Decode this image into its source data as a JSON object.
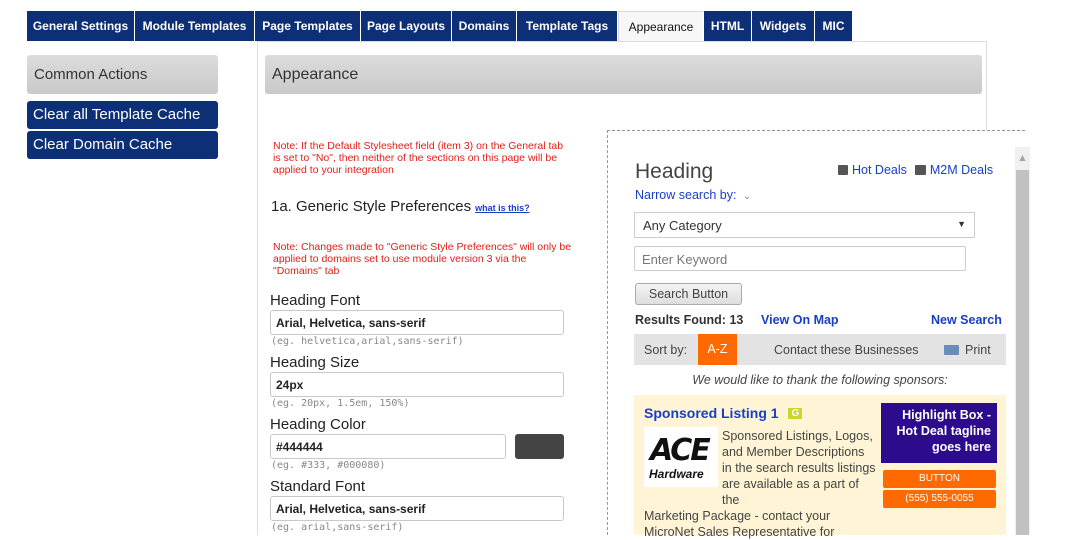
{
  "tabs": [
    {
      "label": "General Settings",
      "w": 108,
      "active": false
    },
    {
      "label": "Module Templates",
      "w": 120,
      "active": false
    },
    {
      "label": "Page Templates",
      "w": 106,
      "active": false
    },
    {
      "label": "Page Layouts",
      "w": 91,
      "active": false
    },
    {
      "label": "Domains",
      "w": 65,
      "active": false
    },
    {
      "label": "Template Tags",
      "w": 101,
      "active": false
    },
    {
      "label": "Appearance",
      "w": 86,
      "active": true
    },
    {
      "label": "HTML",
      "w": 48,
      "active": false
    },
    {
      "label": "Widgets",
      "w": 63,
      "active": false
    },
    {
      "label": "MIC",
      "w": 38,
      "active": false
    }
  ],
  "sidebar": {
    "title": "Common Actions",
    "actions": [
      "Clear all Template Cache",
      "Clear Domain Cache"
    ]
  },
  "panel": {
    "title": "Appearance"
  },
  "form": {
    "note1": "Note: If the Default Stylesheet field (item 3) on the General tab is set to \"No\", then neither of the sections on this page will be applied to your integration",
    "section_title": "1a. Generic Style Preferences",
    "what_link": "what is this?",
    "note2": "Note: Changes made to \"Generic Style Preferences\" will only be applied to domains set to use module version 3 via the \"Domains\" tab",
    "fields": [
      {
        "label": "Heading Font",
        "value": "Arial, Helvetica, sans-serif",
        "hint": "(eg. helvetica,arial,sans-serif)"
      },
      {
        "label": "Heading Size",
        "value": "24px",
        "hint": "(eg. 20px, 1.5em, 150%)"
      },
      {
        "label": "Heading Color",
        "value": "#444444",
        "hint": "(eg. #333, #000080)"
      },
      {
        "label": "Standard Font",
        "value": "Arial, Helvetica, sans-serif",
        "hint": "(eg. arial,sans-serif)"
      }
    ],
    "swatch_color": "#444444"
  },
  "preview": {
    "heading": "Heading",
    "hot_deals": "Hot Deals",
    "m2m_deals": "M2M Deals",
    "narrow": "Narrow search by:",
    "category": "Any Category",
    "keyword_placeholder": "Enter Keyword",
    "search_button": "Search Button",
    "results": "Results Found: 13",
    "view_map": "View On Map",
    "new_search": "New Search",
    "sort_by": "Sort by:",
    "sort_az": "A-Z",
    "contact": "Contact these Businesses",
    "print": "Print",
    "thanks": "We would like to thank the following sponsors:",
    "sponsored_title": "Sponsored Listing 1",
    "sponsored_badge": "G",
    "logo_main": "ACE",
    "logo_sub": "Hardware",
    "sponsored_text": "Sponsored Listings, Logos, and Member Descriptions in the search results listings are available as a part of the",
    "sponsored_text2": "Marketing Package - contact your MicroNet Sales Representative for",
    "highlight": "Highlight Box - Hot Deal tagline goes here",
    "button": "BUTTON",
    "phone": "(555) 555-0055",
    "colors": {
      "link": "#1a3dc8",
      "orange": "#ff6a00",
      "navy": "#2c0c8c",
      "yellow_bg": "#fff5d6"
    }
  }
}
